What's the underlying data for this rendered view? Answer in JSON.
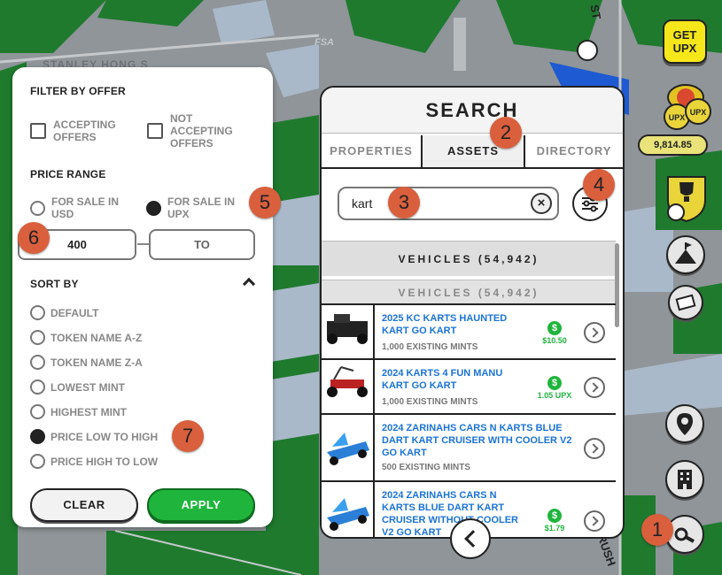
{
  "filter": {
    "offer_title": "FILTER BY OFFER",
    "accepting": "ACCEPTING\nOFFERS",
    "not_accepting": "NOT\nACCEPTING\nOFFERS",
    "price_title": "PRICE RANGE",
    "usd": "FOR SALE IN\nUSD",
    "upx": "FOR SALE IN\nUPX",
    "min_value": "400",
    "max_placeholder": "TO",
    "sort_title": "SORT BY",
    "sort_options": [
      "DEFAULT",
      "TOKEN NAME A-Z",
      "TOKEN NAME Z-A",
      "LOWEST MINT",
      "HIGHEST MINT",
      "PRICE LOW TO HIGH",
      "PRICE HIGH TO LOW"
    ],
    "selected_sort": "PRICE LOW TO HIGH",
    "clear": "CLEAR",
    "apply": "APPLY"
  },
  "search": {
    "title": "SEARCH",
    "tabs": [
      "PROPERTIES",
      "ASSETS",
      "DIRECTORY"
    ],
    "active_tab": "ASSETS",
    "query": "kart",
    "category": "VEHICLES (54,942)",
    "category_sticky": "VEHICLES (54,942)",
    "items": [
      {
        "name": "2025 KC KARTS HAUNTED\nKART GO KART",
        "mints": "1,000 EXISTING MINTS",
        "price": "$10.50"
      },
      {
        "name": "2024 KARTS 4 FUN MANU\nKART GO KART",
        "mints": "1,000 EXISTING MINTS",
        "price": "1.05 UPX"
      },
      {
        "name": "2024 ZARINAHS CARS N KARTS BLUE\nDART KART CRUISER WITH COOLER V2\nGO KART",
        "mints": "500 EXISTING MINTS",
        "price": ""
      },
      {
        "name": "2024 ZARINAHS CARS N\nKARTS BLUE DART KART\nCRUISER WITHOUT COOLER\nV2 GO KART",
        "mints": "",
        "price": "$1.79"
      }
    ]
  },
  "toolbar": {
    "get_upx": "GET\nUPX",
    "balance": "9,814.85"
  },
  "map_labels": {
    "street1": "STANLEY HONG S",
    "street2": "ST",
    "street3": "BRUSH",
    "fsa": "FSA"
  },
  "badges": [
    "1",
    "2",
    "3",
    "4",
    "5",
    "6",
    "7"
  ],
  "colors": {
    "accent_green": "#1fb53c",
    "link_blue": "#1a73d6",
    "badge": "#d95f3d",
    "upx_yellow": "#f5e71a"
  }
}
